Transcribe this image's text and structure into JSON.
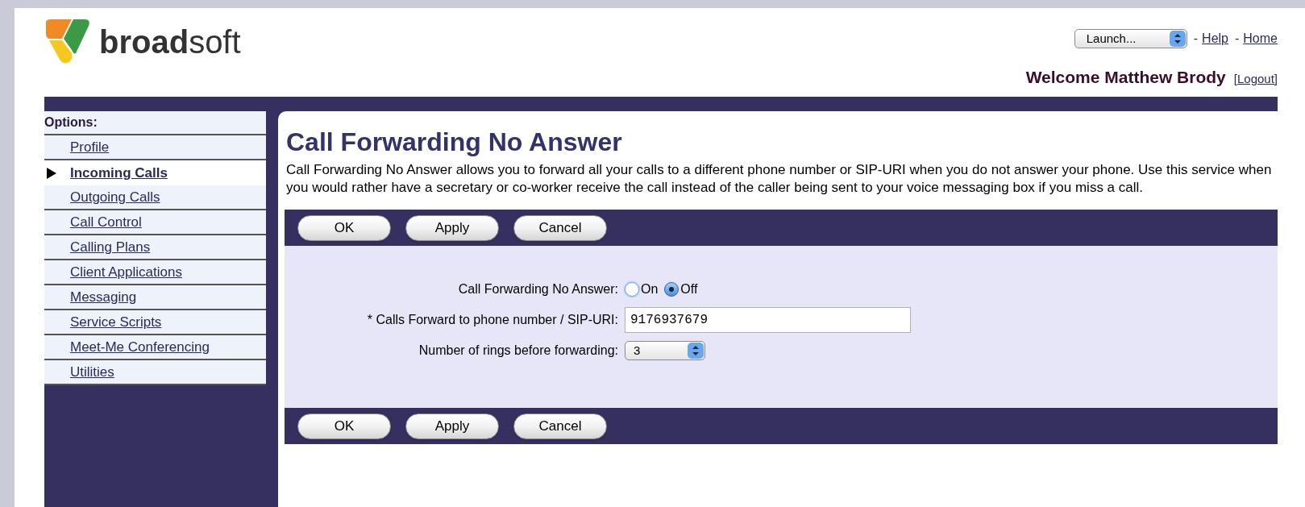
{
  "logo": {
    "text": "**broad**soft"
  },
  "header": {
    "launch_select": {
      "value": "Launch..."
    },
    "links": [
      {
        "separator": "-",
        "label": "Help"
      },
      {
        "separator": "-",
        "label": "Home"
      }
    ],
    "welcome": "Welcome Matthew Brody",
    "logout": "[Logout]"
  },
  "sidebar": {
    "title": "Options:",
    "items": [
      {
        "label": "Profile",
        "selected": false
      },
      {
        "label": "Incoming Calls",
        "selected": true
      },
      {
        "label": "Outgoing Calls",
        "selected": false
      },
      {
        "label": "Call Control",
        "selected": false
      },
      {
        "label": "Calling Plans",
        "selected": false
      },
      {
        "label": "Client Applications",
        "selected": false
      },
      {
        "label": "Messaging",
        "selected": false
      },
      {
        "label": "Service Scripts",
        "selected": false
      },
      {
        "label": "Meet-Me Conferencing",
        "selected": false
      },
      {
        "label": "Utilities",
        "selected": false
      }
    ]
  },
  "page": {
    "title": "Call Forwarding No Answer",
    "description": "Call Forwarding No Answer allows you to forward all your calls to a different phone number or SIP-URI when you do not answer your phone. Use this service when you would rather have a secretary or co-worker receive the call instead of the caller being sent to your voice messaging box if you miss a call."
  },
  "top_buttons": [
    "OK",
    "Apply",
    "Cancel"
  ],
  "form": [
    {
      "kind": "radio",
      "label": "Call Forwarding No Answer:",
      "options": [
        {
          "label": "On",
          "selected": false
        },
        {
          "label": "Off",
          "selected": true
        }
      ]
    },
    {
      "kind": "text",
      "label": "* Calls Forward to phone number / SIP-URI:",
      "value": "9176937679"
    },
    {
      "kind": "select",
      "label": "Number of rings before forwarding:",
      "value": "3"
    }
  ],
  "bottom_buttons": [
    "OK",
    "Apply",
    "Cancel"
  ]
}
